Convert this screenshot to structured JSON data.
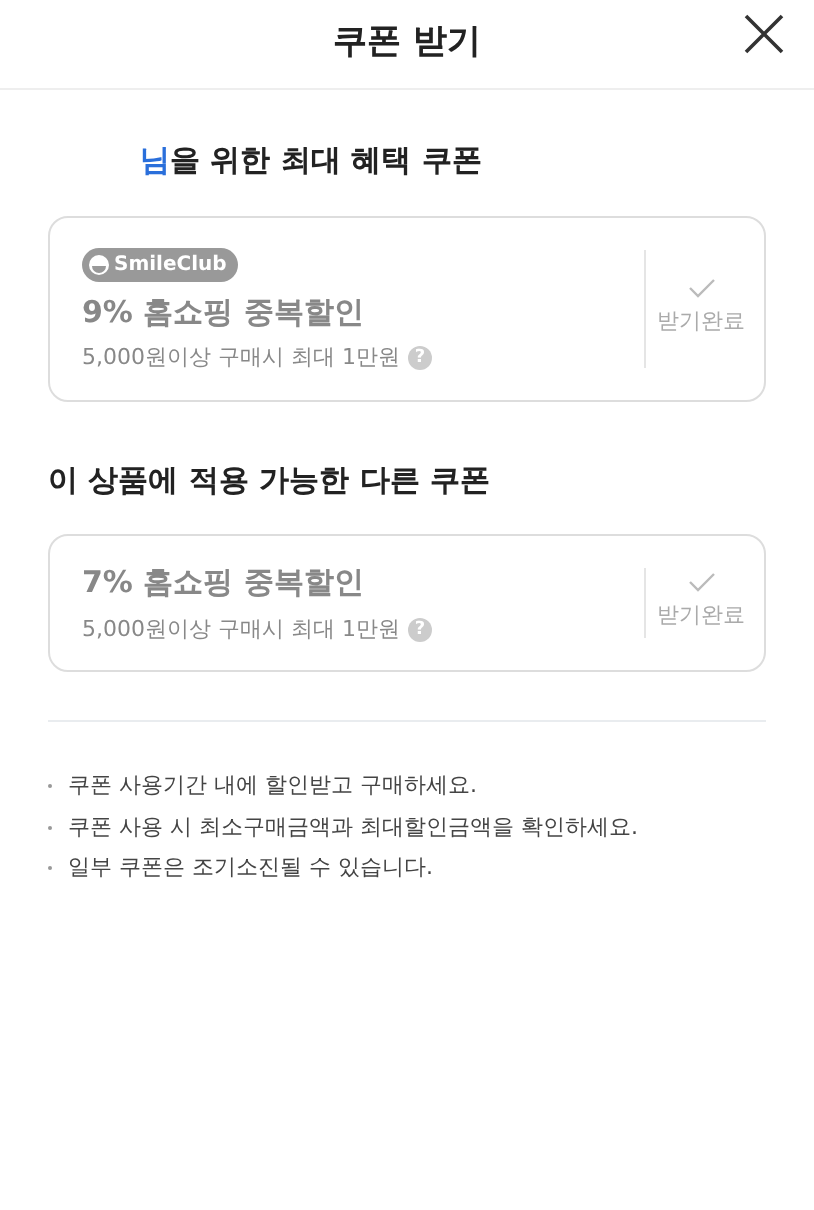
{
  "header": {
    "title": "쿠폰 받기"
  },
  "sections": [
    {
      "heading_highlight": "님",
      "heading": "을 위한 최대 혜택 쿠폰",
      "coupons": [
        {
          "badge": "SmileClub",
          "title": "9% 홈쇼핑 중복할인",
          "condition": "5,000원이상 구매시 최대 1만원",
          "help": "?",
          "status": "받기완료",
          "received": true
        }
      ]
    },
    {
      "heading": "이 상품에 적용 가능한 다른 쿠폰",
      "coupons": [
        {
          "title": "7% 홈쇼핑 중복할인",
          "condition": "5,000원이상 구매시 최대 1만원",
          "help": "?",
          "status": "받기완료",
          "received": true
        }
      ]
    }
  ],
  "notes": [
    "쿠폰 사용기간 내에 할인받고 구매하세요.",
    "쿠폰 사용 시 최소구매금액과 최대할인금액을 확인하세요.",
    "일부 쿠폰은 조기소진될 수 있습니다."
  ]
}
